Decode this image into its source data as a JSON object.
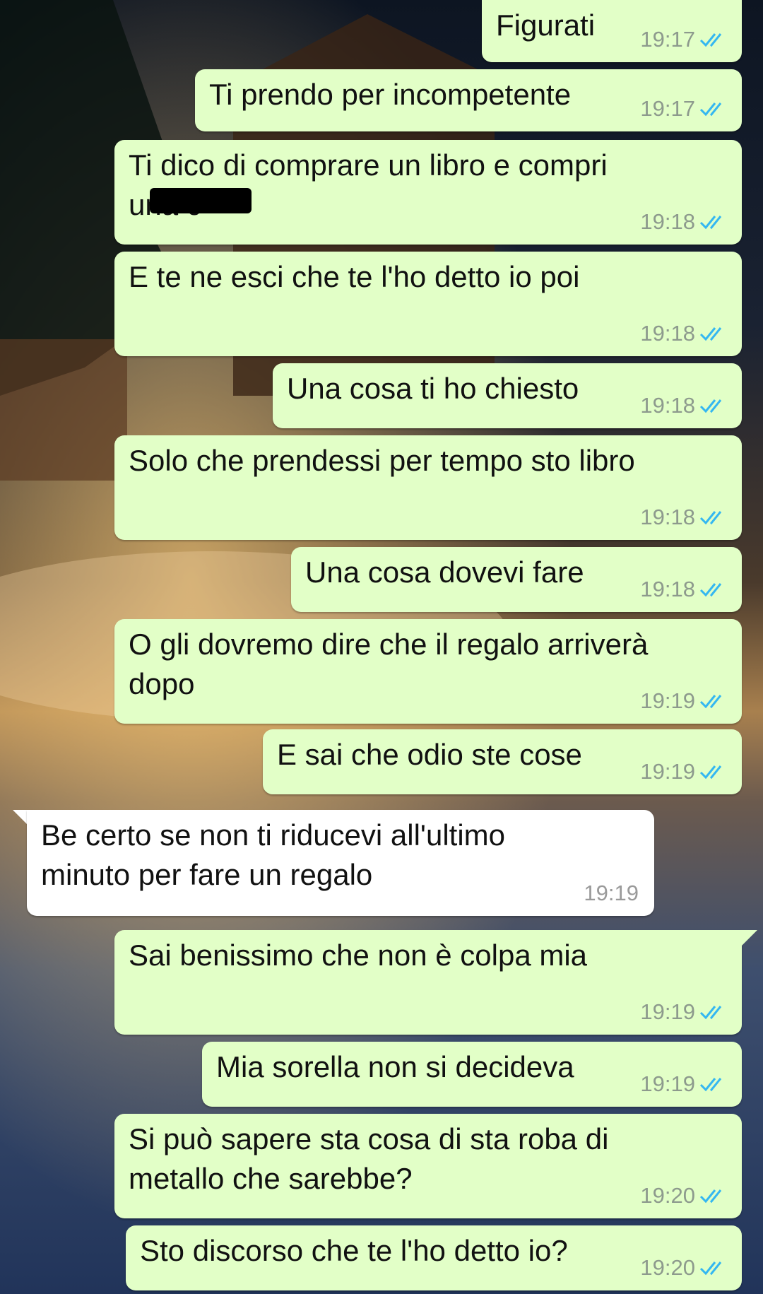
{
  "colors": {
    "outgoing_bubble": "#e2ffc7",
    "incoming_bubble": "#ffffff",
    "read_tick": "#34b7f1"
  },
  "icons": {
    "read_receipt": "double-check-icon"
  },
  "messages": [
    {
      "dir": "out",
      "text": "Figurati",
      "time": "19:17",
      "read": true
    },
    {
      "dir": "out",
      "text": "Ti prendo per incompetente",
      "time": "19:17",
      "read": true
    },
    {
      "dir": "out",
      "text": "Ti dico di comprare un libro e compri una c",
      "time": "19:18",
      "read": true,
      "redacted": true
    },
    {
      "dir": "out",
      "text": "E te ne esci che te l'ho detto io poi",
      "time": "19:18",
      "read": true
    },
    {
      "dir": "out",
      "text": "Una cosa ti ho chiesto",
      "time": "19:18",
      "read": true
    },
    {
      "dir": "out",
      "text": "Solo che prendessi per tempo sto libro",
      "time": "19:18",
      "read": true
    },
    {
      "dir": "out",
      "text": "Una cosa dovevi fare",
      "time": "19:18",
      "read": true
    },
    {
      "dir": "out",
      "text": "O gli dovremo dire che il regalo arriverà dopo",
      "time": "19:19",
      "read": true
    },
    {
      "dir": "out",
      "text": "E sai che odio ste cose",
      "time": "19:19",
      "read": true
    },
    {
      "dir": "in",
      "text": "Be certo se non ti riducevi all'ultimo minuto per fare un regalo",
      "time": "19:19"
    },
    {
      "dir": "out",
      "text": "Sai benissimo che non è colpa mia",
      "time": "19:19",
      "read": true
    },
    {
      "dir": "out",
      "text": "Mia sorella non si decideva",
      "time": "19:19",
      "read": true
    },
    {
      "dir": "out",
      "text": "Si può sapere sta cosa di sta roba di metallo che sarebbe?",
      "time": "19:20",
      "read": true
    },
    {
      "dir": "out",
      "text": "Sto discorso che te l'ho detto io?",
      "time": "19:20",
      "read": true
    }
  ]
}
